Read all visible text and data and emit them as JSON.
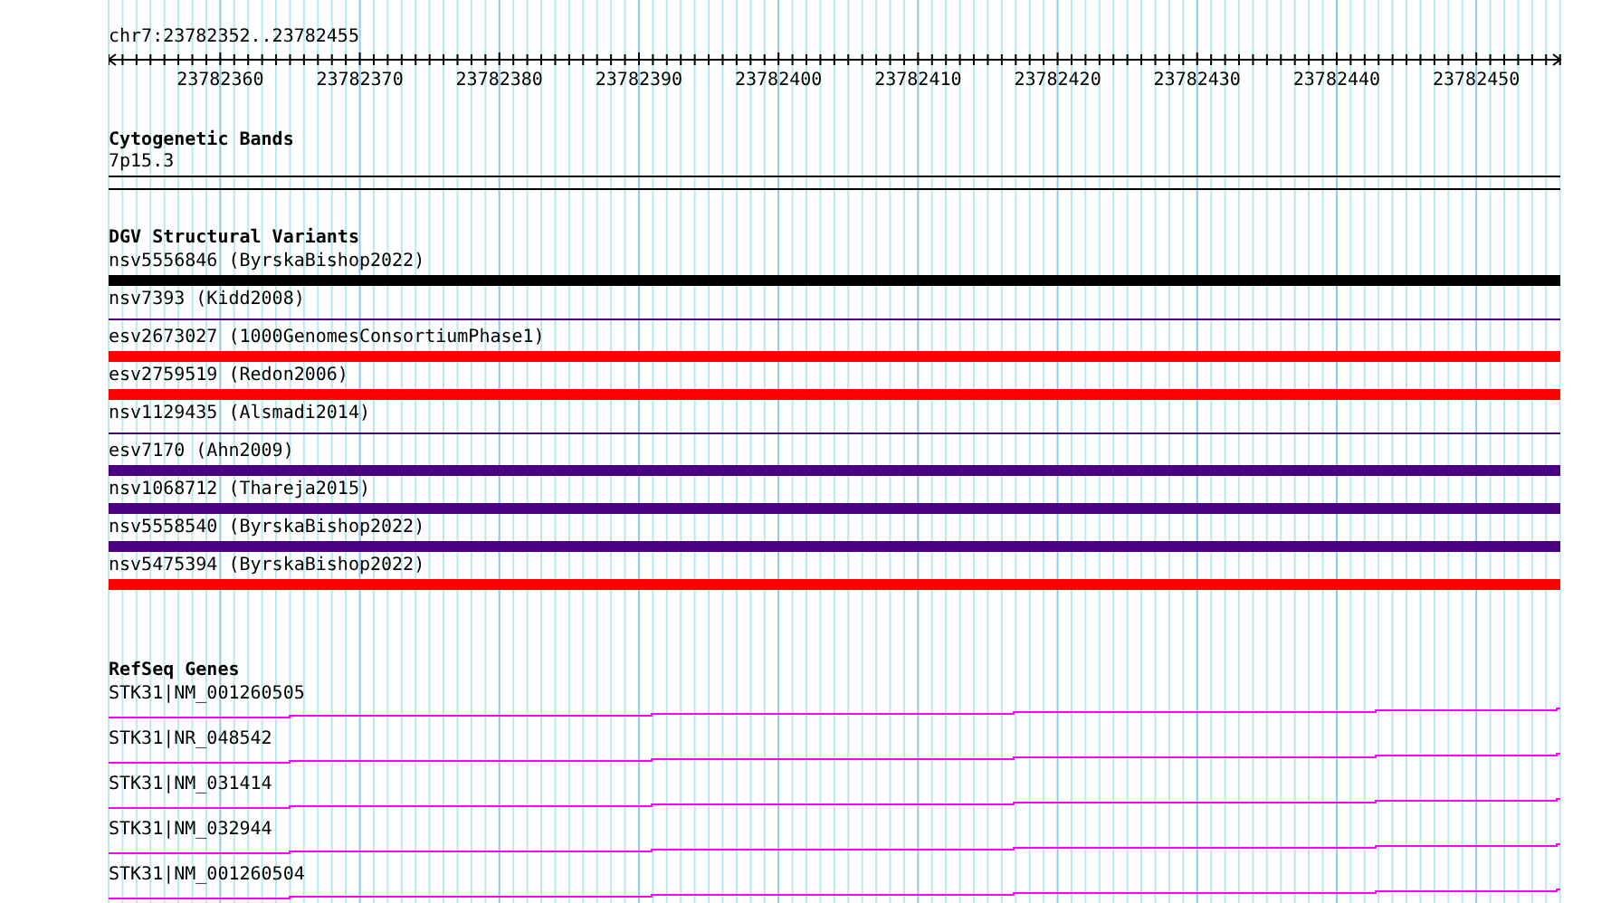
{
  "ruler": {
    "position": "chr7:23782352..23782455",
    "tick_labels": [
      "23782360",
      "23782370",
      "23782380",
      "23782390",
      "23782400",
      "23782410",
      "23782420",
      "23782430",
      "23782440",
      "23782450"
    ]
  },
  "cytogenetic_bands": {
    "title": "Cytogenetic Bands",
    "band": "7p15.3"
  },
  "dgv_structural_variants": {
    "title": "DGV Structural Variants",
    "items": [
      {
        "label": "nsv5556846 (ByrskaBishop2022)",
        "kind": "bar",
        "color": "#000000"
      },
      {
        "label": "nsv7393 (Kidd2008)",
        "kind": "line",
        "color": "#4b0082"
      },
      {
        "label": "esv2673027 (1000GenomesConsortiumPhase1)",
        "kind": "bar",
        "color": "#ff0000"
      },
      {
        "label": "esv2759519 (Redon2006)",
        "kind": "bar",
        "color": "#ff0000"
      },
      {
        "label": "nsv1129435 (Alsmadi2014)",
        "kind": "line",
        "color": "#4b0082"
      },
      {
        "label": "esv7170 (Ahn2009)",
        "kind": "bar",
        "color": "#4b0082"
      },
      {
        "label": "nsv1068712 (Thareja2015)",
        "kind": "bar",
        "color": "#4b0082"
      },
      {
        "label": "nsv5558540 (ByrskaBishop2022)",
        "kind": "bar",
        "color": "#4b0082"
      },
      {
        "label": "nsv5475394 (ByrskaBishop2022)",
        "kind": "bar",
        "color": "#ff0000"
      }
    ]
  },
  "refseq_genes": {
    "title": "RefSeq Genes",
    "items": [
      {
        "label": "STK31|NM_001260505"
      },
      {
        "label": "STK31|NR_048542"
      },
      {
        "label": "STK31|NM_031414"
      },
      {
        "label": "STK31|NM_032944"
      },
      {
        "label": "STK31|NM_001260504"
      }
    ]
  }
}
